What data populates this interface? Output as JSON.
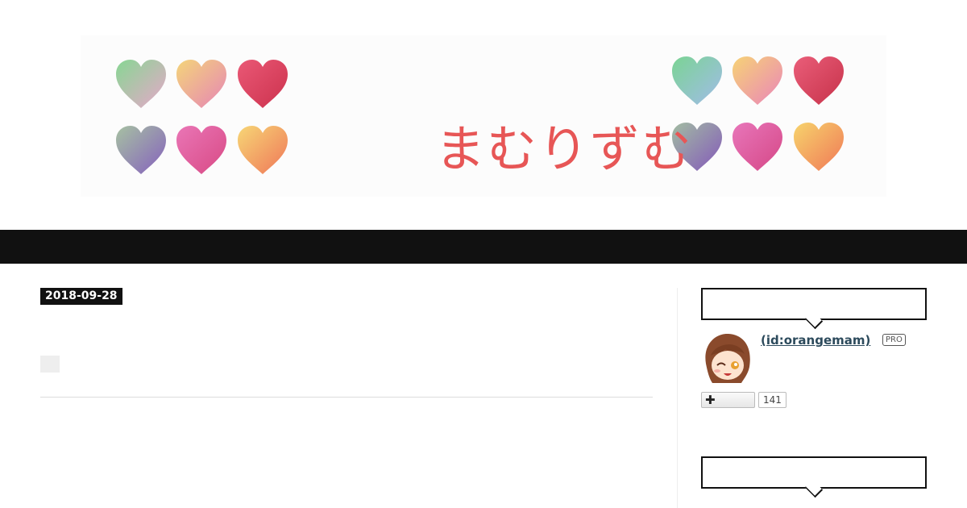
{
  "banner": {
    "title": "まむりずむ",
    "title_color": "#e75656",
    "hearts": [
      {
        "colors": [
          "#7dd38a",
          "#e6a0c6"
        ]
      },
      {
        "colors": [
          "#f3d16e",
          "#e47ab0"
        ]
      },
      {
        "colors": [
          "#e84a6a",
          "#c8203e"
        ]
      },
      {
        "colors": [
          "#9fbc9a",
          "#7b52b8"
        ]
      },
      {
        "colors": [
          "#e86ab0",
          "#d53a7a"
        ]
      },
      {
        "colors": [
          "#f6d36a",
          "#ee6a4a"
        ]
      },
      {
        "colors": [
          "#6fd08a",
          "#9ab6e8"
        ]
      },
      {
        "colors": [
          "#f6cf6a",
          "#e87ab4"
        ]
      },
      {
        "colors": [
          "#e8506e",
          "#c2203a"
        ]
      },
      {
        "colors": [
          "#9ab79a",
          "#7a4ab4"
        ]
      },
      {
        "colors": [
          "#e66ab4",
          "#d2387c"
        ]
      },
      {
        "colors": [
          "#f6d060",
          "#ef6c48"
        ]
      }
    ]
  },
  "nav": {
    "background": "#111111"
  },
  "entry": {
    "date": "2018-09-28"
  },
  "sidebar": {
    "profile": {
      "user_id": " (id:orangemam)",
      "pro_label": "PRO",
      "follow_icon": "plus-icon",
      "follower_count": "141"
    }
  }
}
